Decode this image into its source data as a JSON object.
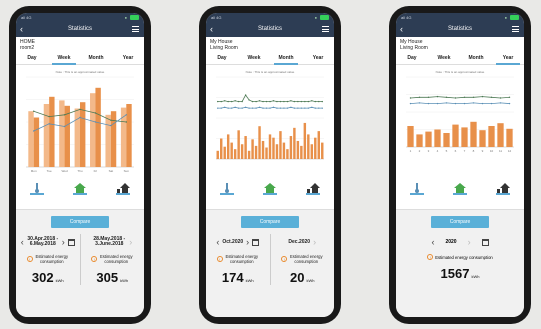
{
  "phones": [
    {
      "header": {
        "title": "Statistics",
        "signal": "all 4G"
      },
      "location": {
        "line1": "HOME",
        "line2": "room2"
      },
      "tabs": [
        "Day",
        "Week",
        "Month",
        "Year"
      ],
      "active_tab": "Week",
      "chart_note": "Note : This is an approximated value",
      "compare_label": "Compare",
      "periods": [
        {
          "range": "30.Apr.2018 - 6.May.2018",
          "estimate_label": "Estimated energy consumption",
          "value": "302",
          "unit": "kWh"
        },
        {
          "range": "28.May.2018 - 3.June.2018",
          "estimate_label": "Estimated energy consumption",
          "value": "305",
          "unit": "kWh"
        }
      ],
      "chart_data": {
        "type": "bar",
        "categories": [
          "Mon",
          "Tue",
          "Wed",
          "Thu",
          "Fri",
          "Sat",
          "Sun"
        ],
        "series": [
          {
            "values": [
              62,
              70,
              74,
              65,
              82,
              58,
              66
            ]
          },
          {
            "values": [
              55,
              78,
              68,
              72,
              88,
              62,
              70
            ]
          }
        ],
        "lines": [
          {
            "values": [
              62,
              56,
              58,
              64,
              60,
              52,
              50
            ]
          },
          {
            "values": [
              40,
              48,
              45,
              55,
              50,
              46,
              58
            ]
          }
        ]
      }
    },
    {
      "header": {
        "title": "Statistics",
        "signal": "all 4G"
      },
      "location": {
        "line1": "My House",
        "line2": "Living Room"
      },
      "tabs": [
        "Day",
        "Week",
        "Month",
        "Year"
      ],
      "active_tab": "Month",
      "chart_note": "Note : This is an approximated value",
      "compare_label": "Compare",
      "periods": [
        {
          "range": "Oct.2020",
          "estimate_label": "Estimated energy consumption",
          "value": "174",
          "unit": "kWh"
        },
        {
          "range": "Dec.2020",
          "estimate_label": "Estimated energy consumption",
          "value": "20",
          "unit": "kWh"
        }
      ],
      "chart_data": {
        "type": "bar",
        "values": [
          10,
          25,
          15,
          30,
          20,
          12,
          35,
          18,
          28,
          10,
          24,
          16,
          40,
          22,
          14,
          30,
          26,
          18,
          34,
          20,
          12,
          28,
          38,
          22,
          16,
          44,
          30,
          18,
          26,
          34,
          20
        ],
        "lines": [
          {
            "values": [
              70,
              70,
              71,
              70,
              70,
              71,
              70,
              70,
              78,
              72,
              70,
              70,
              71,
              70,
              70,
              70,
              71,
              70,
              70,
              70,
              70,
              71,
              70,
              70,
              70,
              70,
              70,
              71,
              70,
              70,
              70
            ]
          },
          {
            "values": [
              62,
              62,
              63,
              62,
              62,
              63,
              62,
              62,
              63,
              62,
              62,
              62,
              63,
              62,
              62,
              62,
              63,
              62,
              62,
              62,
              62,
              63,
              62,
              62,
              62,
              62,
              62,
              63,
              62,
              62,
              62
            ]
          }
        ]
      }
    },
    {
      "header": {
        "title": "Statistics",
        "signal": "all 4G"
      },
      "location": {
        "line1": "My House",
        "line2": "Living Room"
      },
      "tabs": [
        "Day",
        "Week",
        "Month",
        "Year"
      ],
      "active_tab": "Year",
      "chart_note": "Note : This is an approximated value",
      "compare_label": "Compare",
      "year": "2020",
      "estimate_label": "Estimated energy consumption",
      "value": "1567",
      "unit": "kWh",
      "chart_data": {
        "type": "bar",
        "categories": [
          "1",
          "2",
          "3",
          "4",
          "5",
          "6",
          "7",
          "8",
          "9",
          "10",
          "11",
          "12"
        ],
        "values": [
          30,
          18,
          22,
          25,
          20,
          32,
          28,
          36,
          24,
          30,
          34,
          26
        ],
        "lines": [
          {
            "values": [
              70,
              71,
              71,
              72,
              71,
              70,
              71,
              71,
              72,
              71,
              70,
              71
            ]
          },
          {
            "values": [
              62,
              63,
              62,
              62,
              63,
              62,
              62,
              63,
              62,
              62,
              63,
              62
            ]
          }
        ]
      }
    }
  ],
  "colors": {
    "header": "#2d3d54",
    "bar": "#e8904a",
    "accent": "#5ab0d8",
    "line_green": "#4e7a55",
    "line_blue": "#5a8fb5"
  }
}
